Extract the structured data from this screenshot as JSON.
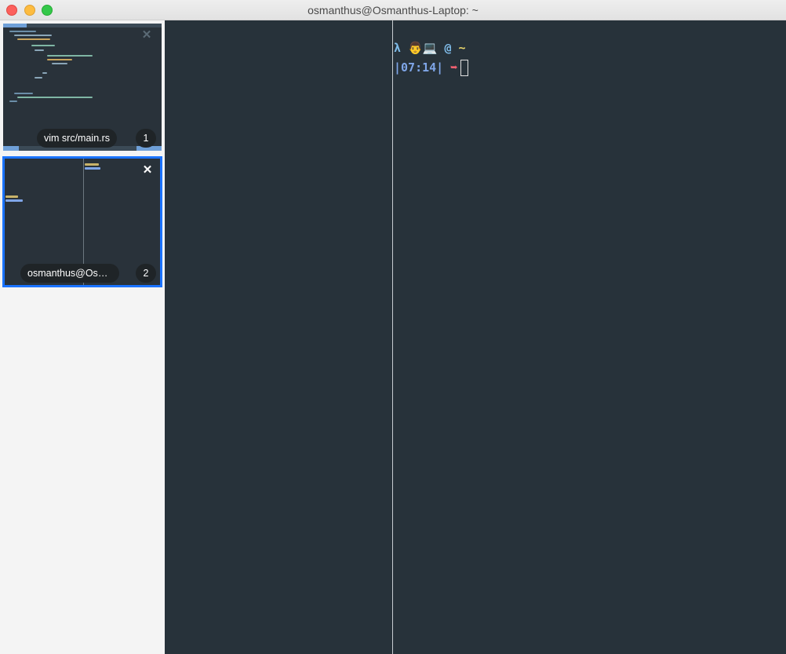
{
  "window": {
    "title": "osmanthus@Osmanthus-Laptop: ~"
  },
  "sidebar": {
    "thumbnails": [
      {
        "label": "vim src/main.rs",
        "number": "1",
        "close": "✕"
      },
      {
        "label": "osmanthus@Osmanthus-Laptop: ~",
        "number": "2",
        "close": "✕",
        "selected": true
      }
    ]
  },
  "terminal": {
    "prompt_line1": {
      "lambda": "λ",
      "emoji": "👨💻",
      "at": "@",
      "dir": "~"
    },
    "prompt_line2": {
      "time": "|07:14|",
      "arrow": "➥"
    }
  },
  "colors": {
    "terminal_bg": "#27323a",
    "selected_border": "#1a73ff",
    "lambda": "#7fbbe8",
    "time": "#7fa6e8",
    "arrow": "#f06070"
  }
}
